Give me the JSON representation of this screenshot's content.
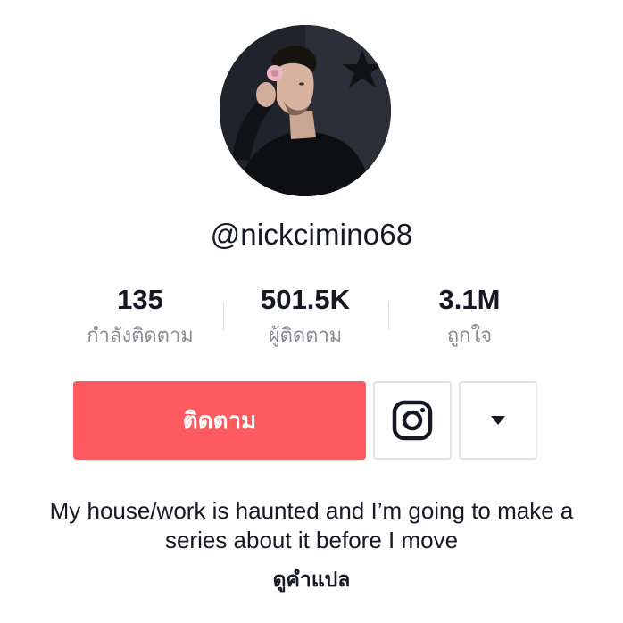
{
  "profile": {
    "username": "@nickcimino68",
    "avatar_icon": "profile-photo"
  },
  "stats": [
    {
      "value": "135",
      "label": "กำลังติดตาม"
    },
    {
      "value": "501.5K",
      "label": "ผู้ติดตาม"
    },
    {
      "value": "3.1M",
      "label": "ถูกใจ"
    }
  ],
  "actions": {
    "follow_label": "ติดตาม",
    "instagram_icon": "instagram-icon",
    "more_icon": "caret-down-icon"
  },
  "bio": {
    "line1": "My house/work is haunted and I’m going to make a",
    "line2": "series about it before I move",
    "translate_label": "ดูคำแปล"
  },
  "colors": {
    "follow_button": "#fe5a5f",
    "text_primary": "#161823",
    "text_secondary": "#8a8b91",
    "border": "#e3e3e4"
  }
}
